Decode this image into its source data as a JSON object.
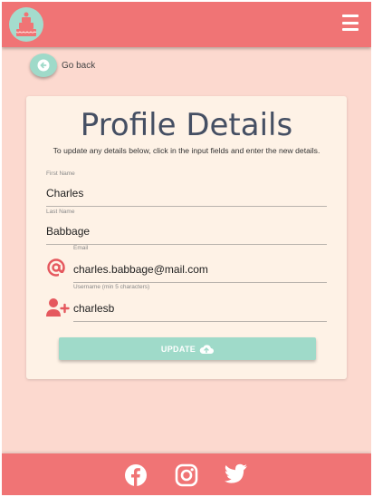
{
  "header": {
    "logo_icon": "cake-logo-icon",
    "menu_icon": "hamburger-menu-icon"
  },
  "nav": {
    "go_back_label": "Go back",
    "go_back_icon": "arrow-left-circle-icon"
  },
  "profile": {
    "title": "Profile Details",
    "subtitle": "To update any details below, click in the input fields and enter the new details.",
    "fields": {
      "first_name": {
        "label": "First Name",
        "value": "Charles"
      },
      "last_name": {
        "label": "Last Name",
        "value": "Babbage"
      },
      "email": {
        "label": "Email",
        "value": "charles.babbage@mail.com",
        "icon": "at-icon"
      },
      "username": {
        "label": "Username (min 5 characters)",
        "value": "charlesb",
        "icon": "user-plus-icon"
      }
    },
    "update_label": "UPDATE",
    "update_icon": "cloud-upload-icon"
  },
  "footer": {
    "social": [
      "facebook-icon",
      "instagram-icon",
      "twitter-icon"
    ]
  },
  "colors": {
    "header_bg": "#f07475",
    "page_bg": "#fcd9cf",
    "card_bg": "#fef2e6",
    "accent_mint": "#9fdac9",
    "title_color": "#454f63",
    "icon_red": "#e5585e"
  }
}
